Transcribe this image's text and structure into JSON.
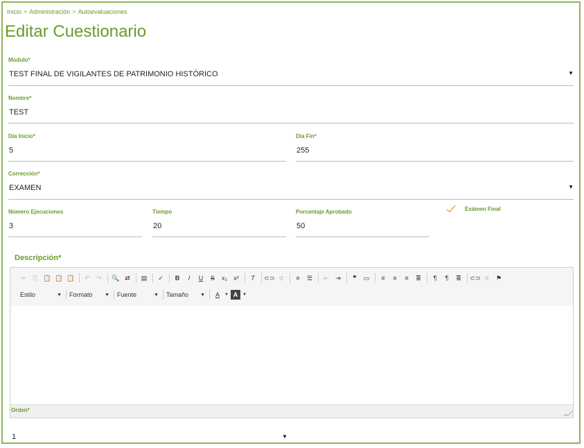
{
  "breadcrumb": {
    "home": "Inicio",
    "section": "Administración",
    "page": "Autoevaluaciones",
    "separator": ">"
  },
  "title": "Editar Cuestionario",
  "fields": {
    "modulo": {
      "label": "Modulo*",
      "value": "TEST FINAL DE VIGILANTES DE PATRIMONIO HISTÓRICO"
    },
    "nombre": {
      "label": "Nombre*",
      "value": "TEST"
    },
    "dia_inicio": {
      "label": "Día Inicio*",
      "value": "5"
    },
    "dia_fin": {
      "label": "Día Fin*",
      "value": "255"
    },
    "correccion": {
      "label": "Corrección*",
      "value": "EXAMEN"
    },
    "numero_ejecuciones": {
      "label": "Número Ejecuciones",
      "value": "3"
    },
    "tiempo": {
      "label": "Tiempo",
      "value": "20"
    },
    "porcentaje": {
      "label": "Porcentaje Aprobado",
      "value": "50"
    },
    "examen_final": {
      "label": "Exámen Final",
      "checked": true
    },
    "descripcion": {
      "label": "Descripción*"
    },
    "orden": {
      "label": "Orden*",
      "value": "1"
    }
  },
  "editor": {
    "combos": {
      "estilo": "Estilo",
      "formato": "Formato",
      "fuente": "Fuente",
      "tamano": "Tamaño"
    }
  },
  "colors": {
    "accent": "#6a9a2a",
    "border": "#8fb25a",
    "check": "#f0a030"
  }
}
